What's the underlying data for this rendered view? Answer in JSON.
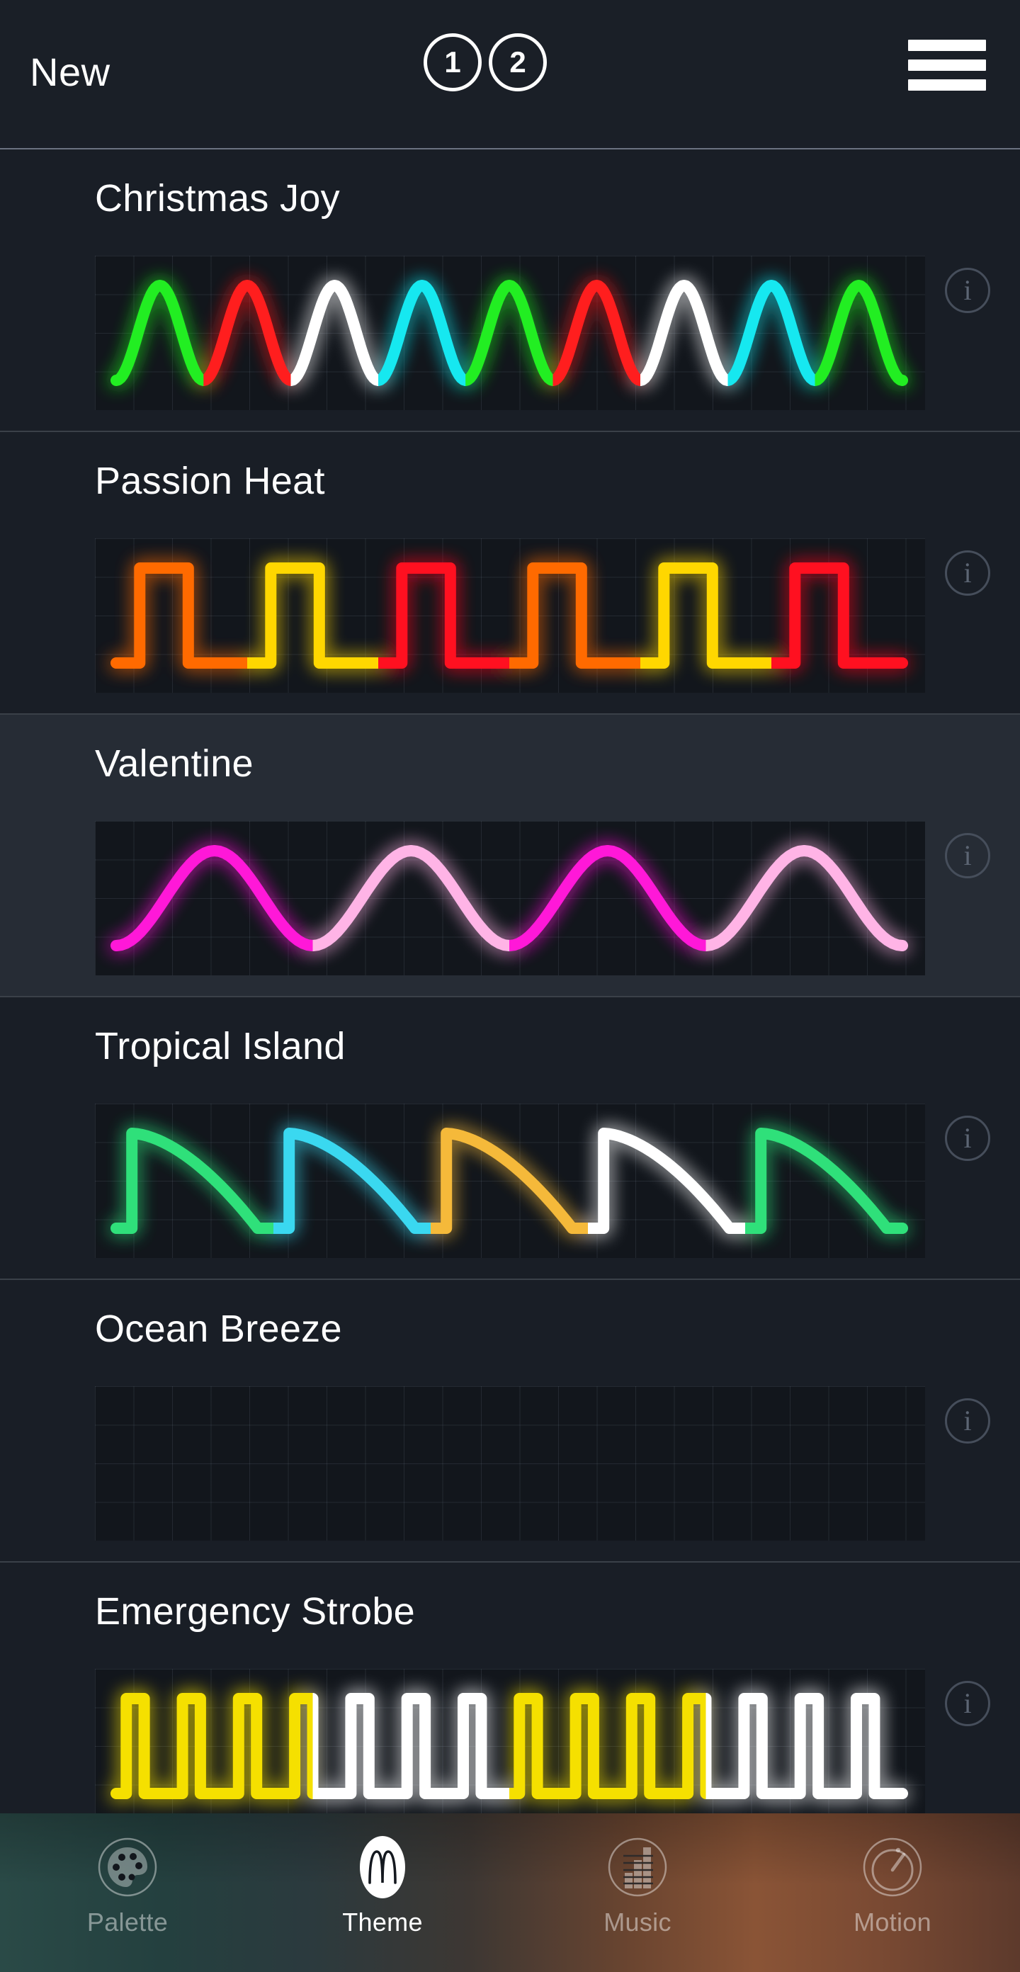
{
  "header": {
    "title": "New",
    "scene_buttons": [
      {
        "label": "1"
      },
      {
        "label": "2"
      }
    ],
    "menu_icon": "hamburger-menu-icon"
  },
  "list": {
    "items": [
      {
        "name": "Christmas Joy",
        "info_label": "i",
        "wave_type": "sine",
        "colors": [
          "#22ee22",
          "#ff1e1e",
          "#ffffff",
          "#16e8f0",
          "#22ee22",
          "#ff1e1e",
          "#ffffff",
          "#16e8f0",
          "#22ee22"
        ],
        "background": "dark"
      },
      {
        "name": "Passion Heat",
        "info_label": "i",
        "wave_type": "square",
        "colors": [
          "#ff6a00",
          "#ffd700",
          "#ff1020",
          "#ff6a00",
          "#ffd700",
          "#ff1020"
        ],
        "background": "dark"
      },
      {
        "name": "Valentine",
        "info_label": "i",
        "wave_type": "sine",
        "colors": [
          "#ff18d8",
          "#ffb4e6",
          "#ff18d8",
          "#ffb4e6"
        ],
        "background": "light"
      },
      {
        "name": "Tropical Island",
        "info_label": "i",
        "wave_type": "sawtooth",
        "colors": [
          "#2fe07a",
          "#3ad8f0",
          "#f5b93a",
          "#ffffff",
          "#2fe07a"
        ],
        "background": "dark"
      },
      {
        "name": "Ocean Breeze",
        "info_label": "i",
        "wave_type": "flat",
        "colors": [
          "#1494f0",
          "#ffffff",
          "#1494f0",
          "#ffffff"
        ],
        "background": "dark"
      },
      {
        "name": "Emergency Strobe",
        "info_label": "i",
        "wave_type": "strobe",
        "colors": [
          "#f5e000",
          "#ffffff",
          "#f5e000",
          "#ffffff"
        ],
        "background": "dark"
      }
    ]
  },
  "tabbar": {
    "tabs": [
      {
        "label": "Palette",
        "icon": "palette-icon",
        "active": false
      },
      {
        "label": "Theme",
        "icon": "waveform-icon",
        "active": true
      },
      {
        "label": "Music",
        "icon": "equalizer-icon",
        "active": false
      },
      {
        "label": "Motion",
        "icon": "stopwatch-icon",
        "active": false
      }
    ]
  },
  "chart_data": [
    {
      "type": "line",
      "title": "Christmas Joy",
      "waveform": "sine",
      "cycles": 9,
      "segment_colors": [
        "#22ee22",
        "#ff1e1e",
        "#ffffff",
        "#16e8f0",
        "#22ee22",
        "#ff1e1e",
        "#ffffff",
        "#16e8f0",
        "#22ee22"
      ],
      "xlabel": "",
      "ylabel": "",
      "grid": true
    },
    {
      "type": "line",
      "title": "Passion Heat",
      "waveform": "square",
      "cycles": 6,
      "segment_colors": [
        "#ff6a00",
        "#ffd700",
        "#ff1020",
        "#ff6a00",
        "#ffd700",
        "#ff1020"
      ],
      "xlabel": "",
      "ylabel": "",
      "grid": true
    },
    {
      "type": "line",
      "title": "Valentine",
      "waveform": "sine",
      "cycles": 4,
      "segment_colors": [
        "#ff18d8",
        "#ffb4e6",
        "#ff18d8",
        "#ffb4e6"
      ],
      "xlabel": "",
      "ylabel": "",
      "grid": true
    },
    {
      "type": "line",
      "title": "Tropical Island",
      "waveform": "sawtooth",
      "cycles": 5,
      "segment_colors": [
        "#2fe07a",
        "#3ad8f0",
        "#f5b93a",
        "#ffffff",
        "#2fe07a"
      ],
      "xlabel": "",
      "ylabel": "",
      "grid": true
    },
    {
      "type": "line",
      "title": "Ocean Breeze",
      "waveform": "flat",
      "cycles": 1,
      "segment_colors": [
        "#1494f0",
        "#ffffff",
        "#1494f0",
        "#ffffff"
      ],
      "xlabel": "",
      "ylabel": "",
      "grid": true
    },
    {
      "type": "line",
      "title": "Emergency Strobe",
      "waveform": "strobe",
      "cycles": 14,
      "segment_colors": [
        "#f5e000",
        "#ffffff",
        "#f5e000",
        "#ffffff"
      ],
      "xlabel": "",
      "ylabel": "",
      "grid": true
    }
  ]
}
